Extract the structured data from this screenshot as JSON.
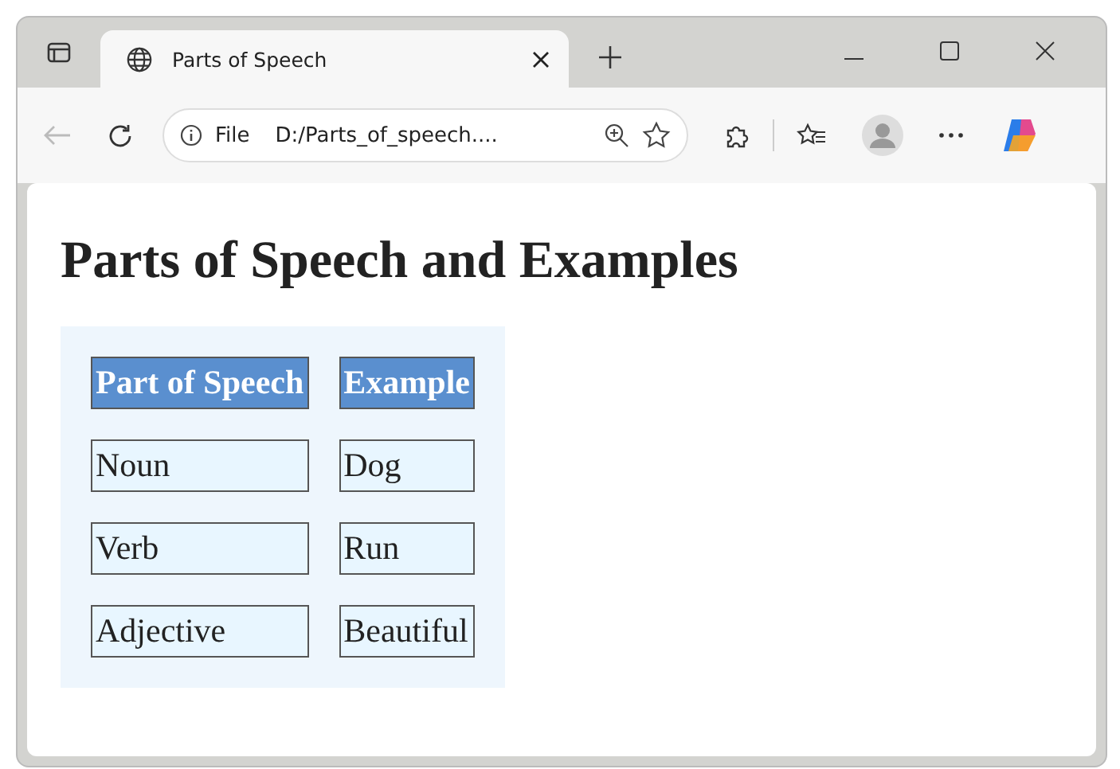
{
  "browser": {
    "tab": {
      "title": "Parts of Speech",
      "selected": true
    },
    "address": {
      "scheme_label": "File",
      "url": "D:/Parts_of_speech...."
    }
  },
  "page": {
    "heading": "Parts of Speech and Examples",
    "table": {
      "columns": [
        "Part of Speech",
        "Example"
      ],
      "rows": [
        [
          "Noun",
          "Dog"
        ],
        [
          "Verb",
          "Run"
        ],
        [
          "Adjective",
          "Beautiful"
        ]
      ]
    }
  }
}
